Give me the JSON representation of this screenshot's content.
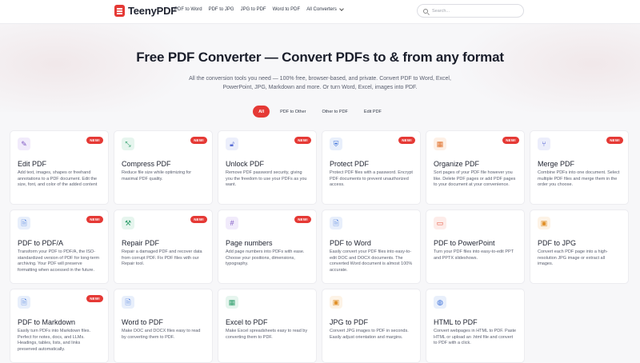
{
  "header": {
    "brand": "TeenyPDF",
    "nav": [
      "PDF to Word",
      "PDF to JPG",
      "JPG to PDF",
      "Word to PDF"
    ],
    "all_converters": "All Converters",
    "search_placeholder": "Search..."
  },
  "hero": {
    "title": "Free PDF Converter — Convert PDFs to & from any format",
    "subtitle": "All the conversion tools you need — 100% free, browser-based, and private. Convert PDF to Word, Excel, PowerPoint, JPG, Markdown and more. Or turn Word, Excel, images into PDF."
  },
  "filters": [
    {
      "label": "All",
      "active": true
    },
    {
      "label": "PDF to Other",
      "active": false
    },
    {
      "label": "Other to PDF",
      "active": false
    },
    {
      "label": "Edit PDF",
      "active": false
    }
  ],
  "badge_label": "NEW!",
  "tools": [
    {
      "name": "edit-pdf",
      "title": "Edit PDF",
      "desc": "Add text, images, shapes or freehand annotations to a PDF document. Edit the size, font, and color of the added content",
      "new": true,
      "icon": "pencil-icon",
      "glyph": "✎",
      "color": "#7e57c2",
      "bg": "#f1ebfb"
    },
    {
      "name": "compress-pdf",
      "title": "Compress PDF",
      "desc": "Reduce file size while optimizing for maximal PDF quality.",
      "new": true,
      "icon": "compress-icon",
      "glyph": "⤡",
      "color": "#2e9e6b",
      "bg": "#e6f5ee"
    },
    {
      "name": "unlock-pdf",
      "title": "Unlock PDF",
      "desc": "Remove PDF password security, giving you the freedom to use your PDFs as you want.",
      "new": true,
      "icon": "unlock-icon",
      "glyph": "🔓︎",
      "color": "#5a6fd6",
      "bg": "#eceffb"
    },
    {
      "name": "protect-pdf",
      "title": "Protect PDF",
      "desc": "Protect PDF files with a password. Encrypt PDF documents to prevent unauthorized access.",
      "new": true,
      "icon": "shield-icon",
      "glyph": "⛨",
      "color": "#3b6fd8",
      "bg": "#e8effb"
    },
    {
      "name": "organize-pdf",
      "title": "Organize PDF",
      "desc": "Sort pages of your PDF file however you like. Delete PDF pages or add PDF pages to your document at your convenience.",
      "new": true,
      "icon": "grid-icon",
      "glyph": "▦",
      "color": "#e0712b",
      "bg": "#fdf0e6"
    },
    {
      "name": "merge-pdf",
      "title": "Merge PDF",
      "desc": "Combine PDFs into one document. Select multiple PDF files and merge them in the order you choose.",
      "new": true,
      "icon": "merge-icon",
      "glyph": "⑂",
      "color": "#4a5ad0",
      "bg": "#eceefb"
    },
    {
      "name": "pdf-to-pdfa",
      "title": "PDF to PDF/A",
      "desc": "Transform your PDF to PDF/A, the ISO-standardized version of PDF for long-term archiving. Your PDF will preserve formatting when accessed in the future.",
      "new": true,
      "icon": "file-icon",
      "glyph": "🗎︎",
      "color": "#3b6fd8",
      "bg": "#e8effb"
    },
    {
      "name": "repair-pdf",
      "title": "Repair PDF",
      "desc": "Repair a damaged PDF and recover data from corrupt PDF. Fix PDF files with our Repair tool.",
      "new": true,
      "icon": "wrench-icon",
      "glyph": "⚒",
      "color": "#2e9e6b",
      "bg": "#e6f5ee"
    },
    {
      "name": "page-numbers",
      "title": "Page numbers",
      "desc": "Add page numbers into PDFs with ease. Choose your positions, dimensions, typography.",
      "new": true,
      "icon": "hash-icon",
      "glyph": "#",
      "color": "#7e57c2",
      "bg": "#f1ebfb"
    },
    {
      "name": "pdf-to-word",
      "title": "PDF to Word",
      "desc": "Easily convert your PDF files into easy-to-edit DOC and DOCX documents. The converted Word document is almost 100% accurate.",
      "new": false,
      "icon": "file-text-icon",
      "glyph": "🗎︎",
      "color": "#3b6fd8",
      "bg": "#e8effb"
    },
    {
      "name": "pdf-to-powerpoint",
      "title": "PDF to PowerPoint",
      "desc": "Turn your PDF files into easy-to-edit PPT and PPTX slideshows.",
      "new": false,
      "icon": "presentation-icon",
      "glyph": "▭",
      "color": "#e5533c",
      "bg": "#fdece9"
    },
    {
      "name": "pdf-to-jpg",
      "title": "PDF to JPG",
      "desc": "Convert each PDF page into a high-resolution JPG image or extract all images.",
      "new": false,
      "icon": "image-icon",
      "glyph": "▣",
      "color": "#e0912b",
      "bg": "#fdf3e6"
    },
    {
      "name": "pdf-to-markdown",
      "title": "PDF to Markdown",
      "desc": "Easily turn PDFs into Markdown files. Perfect for notes, docs, and LLMs. Headings, tables, lists, and links preserved automatically.",
      "new": true,
      "icon": "markdown-file-icon",
      "glyph": "🗎︎",
      "color": "#3b6fd8",
      "bg": "#e8effb"
    },
    {
      "name": "word-to-pdf",
      "title": "Word to PDF",
      "desc": "Make DOC and DOCX files easy to read by converting them to PDF.",
      "new": false,
      "icon": "word-doc-icon",
      "glyph": "🗎︎",
      "color": "#3b6fd8",
      "bg": "#e8effb"
    },
    {
      "name": "excel-to-pdf",
      "title": "Excel to PDF",
      "desc": "Make Excel spreadsheets easy to read by converting them to PDF.",
      "new": false,
      "icon": "spreadsheet-icon",
      "glyph": "▦",
      "color": "#2e9e6b",
      "bg": "#e6f5ee"
    },
    {
      "name": "jpg-to-pdf",
      "title": "JPG to PDF",
      "desc": "Convert JPG images to PDF in seconds. Easily adjust orientation and margins.",
      "new": false,
      "icon": "images-icon",
      "glyph": "▣",
      "color": "#e0912b",
      "bg": "#fdf3e6"
    },
    {
      "name": "html-to-pdf",
      "title": "HTML to PDF",
      "desc": "Convert webpages in HTML to PDF. Paste HTML or upload an .html file and convert to PDF with a click.",
      "new": false,
      "icon": "globe-icon",
      "glyph": "◍",
      "color": "#3b6fd8",
      "bg": "#e8effb"
    }
  ]
}
